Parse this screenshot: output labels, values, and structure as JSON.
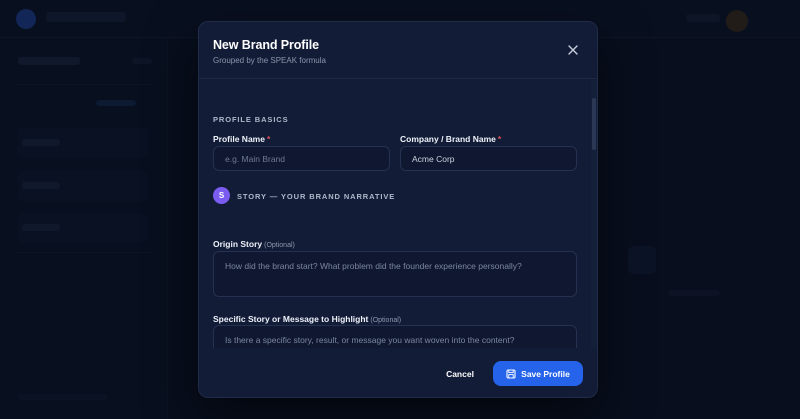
{
  "modal": {
    "title": "New Brand Profile",
    "subtitle": "Grouped by the SPEAK formula",
    "close_icon": "close-icon"
  },
  "profile_basics": {
    "heading": "PROFILE BASICS",
    "profile_name": {
      "label": "Profile Name",
      "required_mark": "*",
      "value": "",
      "placeholder": "e.g. Main Brand"
    },
    "company_name": {
      "label": "Company / Brand Name",
      "required_mark": "*",
      "value": "Acme Corp",
      "placeholder": ""
    }
  },
  "story": {
    "badge": "S",
    "badge_color": "#7b5cf0",
    "heading": "STORY — YOUR BRAND NARRATIVE",
    "origin_story": {
      "label": "Origin Story",
      "optional_note": "(Optional)",
      "value": "",
      "placeholder": "How did the brand start? What problem did the founder experience personally?"
    },
    "specific_story": {
      "label": "Specific Story or Message to Highlight",
      "optional_note": "(Optional)",
      "value": "",
      "placeholder": "Is there a specific story, result, or message you want woven into the content?"
    }
  },
  "footer": {
    "cancel_label": "Cancel",
    "save_label": "Save Profile",
    "save_icon": "save-icon",
    "accent_color": "#2563eb"
  }
}
